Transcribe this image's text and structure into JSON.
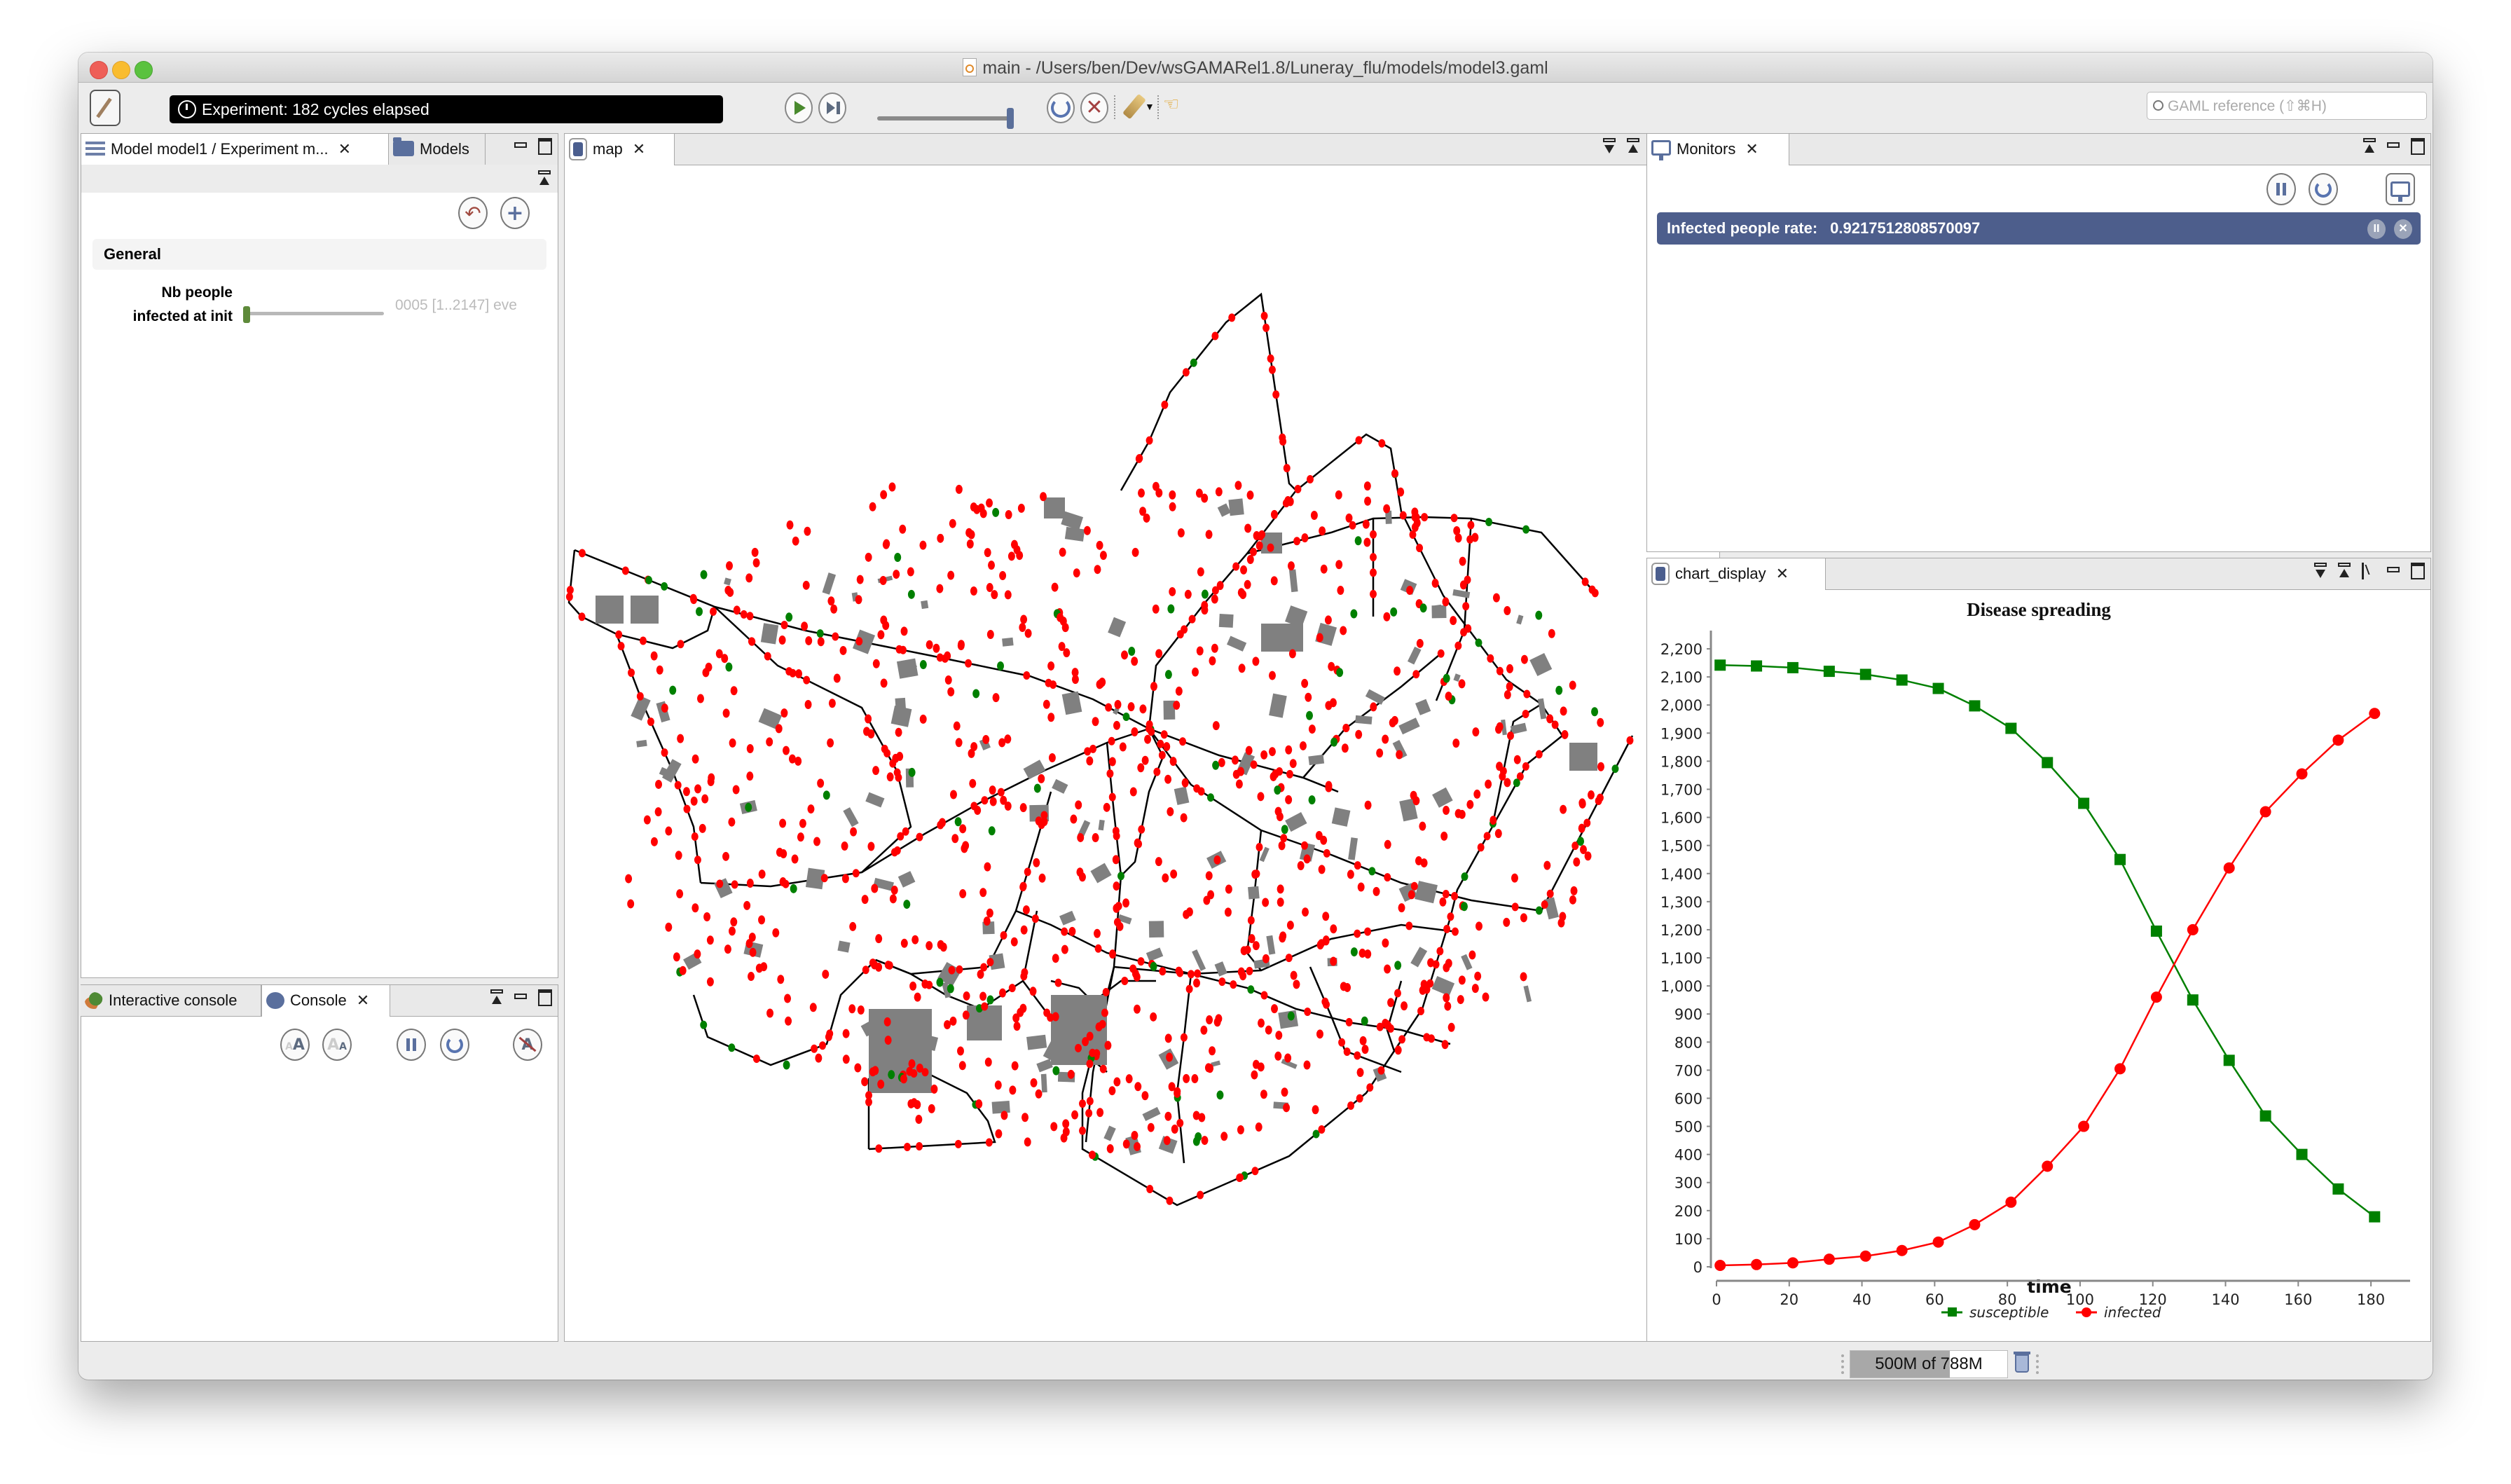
{
  "window": {
    "title": "main - /Users/ben/Dev/wsGAMARel1.8/Luneray_flu/models/model3.gaml"
  },
  "toolbar": {
    "experiment_status": "Experiment: 182 cycles elapsed",
    "speed_fraction": 1.0,
    "search_placeholder": "GAML reference (⇧⌘H)",
    "icons": [
      "editor-icon",
      "clock-icon",
      "play-icon",
      "step-icon",
      "reload-icon",
      "stop-icon",
      "pen-icon",
      "dropdown-icon",
      "hand-pointer-icon",
      "search-icon"
    ]
  },
  "left_panel": {
    "tabs": [
      {
        "label": "Model model1 / Experiment m...",
        "icon": "sliders-icon",
        "active": true,
        "closable": true
      },
      {
        "label": "Models",
        "icon": "folder-icon",
        "active": false
      }
    ],
    "section": "General",
    "parameter": {
      "label_line1": "Nb people",
      "label_line2": "infected at init",
      "value_text": "0005 [1..2147] eve",
      "value": 5,
      "min": 1,
      "max": 2147
    }
  },
  "console_panel": {
    "tabs": [
      {
        "label": "Interactive console",
        "icon": "chat-bubbles-icon",
        "active": false
      },
      {
        "label": "Console",
        "icon": "chat-bubble-icon",
        "active": true,
        "closable": true
      }
    ]
  },
  "map_panel": {
    "tab_label": "map",
    "colors": {
      "road": "#000000",
      "building": "#808080",
      "infected": "#ff0000",
      "susceptible": "#008000"
    }
  },
  "monitors_panel": {
    "tab_label": "Monitors",
    "monitor": {
      "label": "Infected people rate:",
      "value": "0.9217512808570097",
      "color": "#4d5e8c"
    }
  },
  "chart_panel": {
    "tab_label": "chart_display"
  },
  "chart_data": {
    "type": "line",
    "title": "Disease spreading",
    "xlabel": "time",
    "ylabel": "",
    "xlim": [
      0,
      190
    ],
    "ylim": [
      0,
      2250
    ],
    "grid": false,
    "legend": "bottom",
    "x_ticks": [
      0,
      20,
      40,
      60,
      80,
      100,
      120,
      140,
      160,
      180
    ],
    "y_ticks": [
      0,
      100,
      200,
      300,
      400,
      500,
      600,
      700,
      800,
      900,
      1000,
      1100,
      1200,
      1300,
      1400,
      1500,
      1600,
      1700,
      1800,
      1900,
      2000,
      2100,
      2200
    ],
    "y_tick_labels": [
      "0",
      "100",
      "200",
      "300",
      "400",
      "500",
      "600",
      "700",
      "800",
      "900",
      "1,000",
      "1,100",
      "1,200",
      "1,300",
      "1,400",
      "1,500",
      "1,600",
      "1,700",
      "1,800",
      "1,900",
      "2,000",
      "2,100",
      "2,200"
    ],
    "x": [
      1,
      11,
      21,
      31,
      41,
      51,
      61,
      71,
      81,
      91,
      101,
      111,
      121,
      131,
      141,
      151,
      161,
      171,
      181
    ],
    "series": [
      {
        "name": "susceptible",
        "color": "#008000",
        "marker": "square",
        "values": [
          2142,
          2139,
          2133,
          2120,
          2109,
          2089,
          2059,
          1997,
          1917,
          1795,
          1650,
          1450,
          1195,
          950,
          735,
          537,
          400,
          277,
          178
        ]
      },
      {
        "name": "infected",
        "color": "#ff0000",
        "marker": "circle",
        "values": [
          5,
          8,
          14,
          27,
          38,
          58,
          88,
          150,
          230,
          358,
          500,
          705,
          960,
          1200,
          1420,
          1620,
          1755,
          1875,
          1970
        ]
      }
    ]
  },
  "statusbar": {
    "memory_text": "500M of 788M",
    "memory_used_mb": 500,
    "memory_total_mb": 788
  }
}
